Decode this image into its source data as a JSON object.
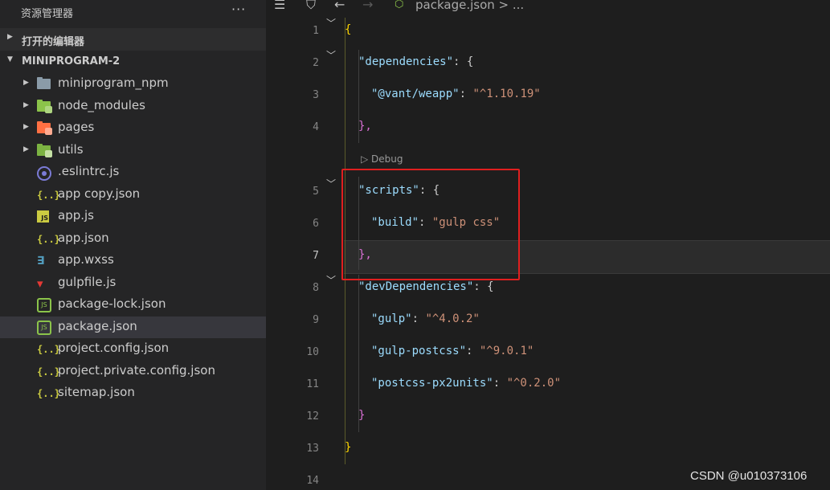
{
  "sidebar": {
    "title": "资源管理器",
    "more": "···",
    "open_editors": "打开的编辑器",
    "project": "MINIPROGRAM-2",
    "items": [
      {
        "name": "miniprogram_npm",
        "icon": "folder-icon"
      },
      {
        "name": "node_modules",
        "icon": "folder-node-icon"
      },
      {
        "name": "pages",
        "icon": "folder-pages-icon"
      },
      {
        "name": "utils",
        "icon": "folder-utils-icon"
      },
      {
        "name": ".eslintrc.js",
        "icon": "eslint-icon"
      },
      {
        "name": "app copy.json",
        "icon": "json-icon"
      },
      {
        "name": "app.js",
        "icon": "js-icon"
      },
      {
        "name": "app.json",
        "icon": "json-icon"
      },
      {
        "name": "app.wxss",
        "icon": "css-icon"
      },
      {
        "name": "gulpfile.js",
        "icon": "gulp-icon"
      },
      {
        "name": "package-lock.json",
        "icon": "nodejs-icon"
      },
      {
        "name": "package.json",
        "icon": "nodejs-icon"
      },
      {
        "name": "project.config.json",
        "icon": "json-icon"
      },
      {
        "name": "project.private.config.json",
        "icon": "json-icon"
      },
      {
        "name": "sitemap.json",
        "icon": "json-icon"
      }
    ]
  },
  "editor": {
    "breadcrumb_file": "package.json",
    "breadcrumb_rest": "> ...",
    "codelens": "▷ Debug",
    "lines": {
      "l1": "{",
      "l2_key": "\"dependencies\"",
      "l2_rest": ": {",
      "l3_key": "\"@vant/weapp\"",
      "l3_val": "\"^1.10.19\"",
      "l4": "},",
      "l5_key": "\"scripts\"",
      "l5_rest": ": {",
      "l6_key": "\"build\"",
      "l6_val": "\"gulp css\"",
      "l7": "},",
      "l8_key": "\"devDependencies\"",
      "l8_rest": ": {",
      "l9_key": "\"gulp\"",
      "l9_val": "\"^4.0.2\"",
      "l10_key": "\"gulp-postcss\"",
      "l10_val": "\"^9.0.1\"",
      "l11_key": "\"postcss-px2units\"",
      "l11_val": "\"^0.2.0\"",
      "l12": "}",
      "l13": "}"
    },
    "line_numbers": [
      "1",
      "2",
      "3",
      "4",
      "5",
      "6",
      "7",
      "8",
      "9",
      "10",
      "11",
      "12",
      "13",
      "14"
    ],
    "active_line": "7"
  },
  "watermark": "CSDN @u010373106",
  "colors": {
    "accent_highlight": "#e01f1f",
    "key": "#9cdcfe",
    "string": "#ce9178"
  }
}
